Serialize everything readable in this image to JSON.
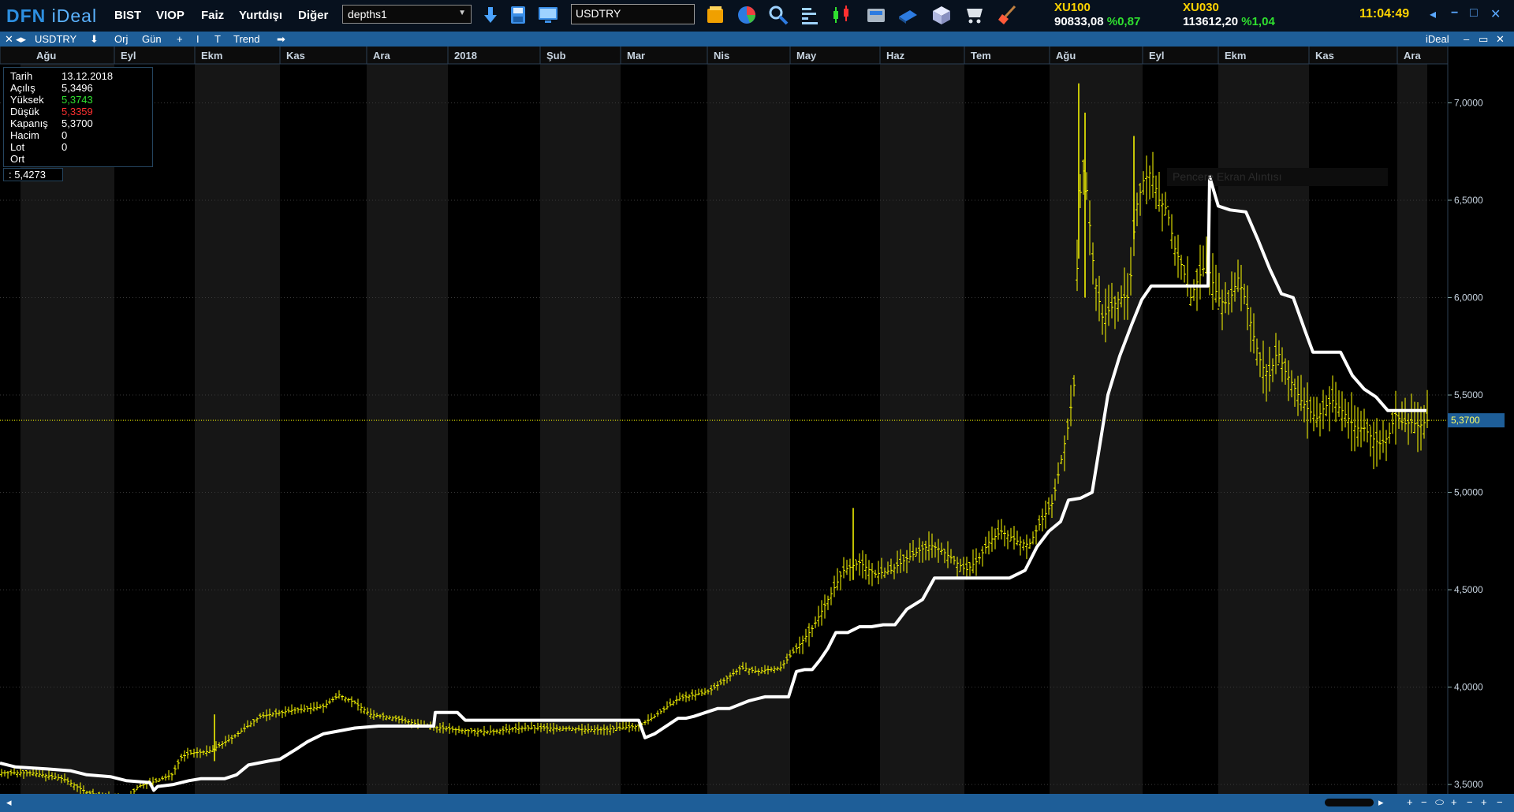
{
  "app": {
    "logo_main": "DFN",
    "logo_sub": "iDeal"
  },
  "menu": [
    {
      "label": "BIST"
    },
    {
      "label": "VIOP"
    },
    {
      "label": "Faiz"
    },
    {
      "label": "Yurtdışı"
    },
    {
      "label": "Diğer"
    }
  ],
  "layout_combo": {
    "value": "depths1"
  },
  "symbol_input": {
    "value": "USDTRY"
  },
  "toolbar_icons": [
    "download-arrow-icon",
    "save-file-icon",
    "monitor-icon",
    "folder-icon",
    "pie-chart-icon",
    "magnifier-icon",
    "align-lines-icon",
    "candlestick-icon",
    "calculator-icon",
    "book-icon",
    "cube-icon",
    "cart-icon",
    "broom-icon"
  ],
  "indices": [
    {
      "name": "XU100",
      "value": "90833,08",
      "pct": "%0,87"
    },
    {
      "name": "XU030",
      "value": "113612,20",
      "pct": "%1,04"
    }
  ],
  "clock": "11:04:49",
  "chart_toolbar": {
    "symbol": "USDTRY",
    "orj": "Orj",
    "period": "Gün",
    "trend": "Trend",
    "brand": "iDeal"
  },
  "info": {
    "rows": [
      {
        "key": "Tarih",
        "value": "13.12.2018",
        "color": "#ffffff"
      },
      {
        "key": "Açılış",
        "value": "5,3496",
        "color": "#ffffff"
      },
      {
        "key": "Yüksek",
        "value": "5,3743",
        "color": "#2fe02f"
      },
      {
        "key": "Düşük",
        "value": "5,3359",
        "color": "#ff3030"
      },
      {
        "key": "Kapanış",
        "value": "5,3700",
        "color": "#ffffff"
      },
      {
        "key": "Hacim",
        "value": "0",
        "color": "#ffffff"
      },
      {
        "key": "Lot",
        "value": "0",
        "color": "#ffffff"
      },
      {
        "key": "Ort",
        "value": "",
        "color": "#ffffff"
      }
    ],
    "cursor_value": ": 5,4273"
  },
  "watermark": "Pencere Ekran Alıntısı",
  "chart_data": {
    "type": "line",
    "title": "",
    "months": [
      "Ağu",
      "Eyl",
      "Ekm",
      "Kas",
      "Ara",
      "2018",
      "Şub",
      "Mar",
      "Nis",
      "May",
      "Haz",
      "Tem",
      "Ağu",
      "Eyl",
      "Ekm",
      "Kas",
      "Ara"
    ],
    "y_ticks": [
      "7,0000",
      "6,5000",
      "6,0000",
      "5,5000",
      "5,0000",
      "4,5000",
      "4,0000",
      "3,5000"
    ],
    "ylim": [
      3.46,
      7.18
    ],
    "last_price_label": "5,3700",
    "last_price": 5.37,
    "price_color": "#ffff00",
    "stop_color": "#ffffff",
    "price_series": {
      "name": "USDTRY",
      "points": [
        [
          0,
          3.56
        ],
        [
          40,
          3.56
        ],
        [
          80,
          3.53
        ],
        [
          110,
          3.46
        ],
        [
          130,
          3.44
        ],
        [
          160,
          3.42
        ],
        [
          175,
          3.49
        ],
        [
          200,
          3.52
        ],
        [
          218,
          3.55
        ],
        [
          230,
          3.64
        ],
        [
          240,
          3.66
        ],
        [
          265,
          3.67
        ],
        [
          295,
          3.74
        ],
        [
          330,
          3.85
        ],
        [
          370,
          3.88
        ],
        [
          410,
          3.9
        ],
        [
          430,
          3.96
        ],
        [
          450,
          3.92
        ],
        [
          470,
          3.86
        ],
        [
          500,
          3.84
        ],
        [
          540,
          3.8
        ],
        [
          580,
          3.78
        ],
        [
          620,
          3.77
        ],
        [
          660,
          3.79
        ],
        [
          700,
          3.79
        ],
        [
          760,
          3.78
        ],
        [
          810,
          3.8
        ],
        [
          830,
          3.85
        ],
        [
          860,
          3.94
        ],
        [
          880,
          3.96
        ],
        [
          900,
          3.98
        ],
        [
          920,
          4.04
        ],
        [
          940,
          4.1
        ],
        [
          960,
          4.08
        ],
        [
          990,
          4.1
        ],
        [
          1010,
          4.2
        ],
        [
          1030,
          4.3
        ],
        [
          1050,
          4.45
        ],
        [
          1070,
          4.6
        ],
        [
          1080,
          4.62
        ],
        [
          1090,
          4.64
        ],
        [
          1110,
          4.58
        ],
        [
          1130,
          4.6
        ],
        [
          1150,
          4.66
        ],
        [
          1165,
          4.7
        ],
        [
          1180,
          4.73
        ],
        [
          1195,
          4.7
        ],
        [
          1210,
          4.65
        ],
        [
          1225,
          4.6
        ],
        [
          1240,
          4.65
        ],
        [
          1255,
          4.75
        ],
        [
          1270,
          4.8
        ],
        [
          1290,
          4.75
        ],
        [
          1305,
          4.73
        ],
        [
          1320,
          4.85
        ],
        [
          1335,
          4.95
        ],
        [
          1345,
          5.15
        ],
        [
          1355,
          5.35
        ],
        [
          1362,
          5.55
        ],
        [
          1367,
          6.3
        ],
        [
          1372,
          6.7
        ],
        [
          1378,
          6.55
        ],
        [
          1388,
          6.1
        ],
        [
          1398,
          5.9
        ],
        [
          1410,
          5.95
        ],
        [
          1420,
          6.0
        ],
        [
          1432,
          6.0
        ],
        [
          1440,
          6.45
        ],
        [
          1450,
          6.6
        ],
        [
          1460,
          6.65
        ],
        [
          1470,
          6.5
        ],
        [
          1480,
          6.45
        ],
        [
          1490,
          6.25
        ],
        [
          1500,
          6.15
        ],
        [
          1510,
          6.0
        ],
        [
          1520,
          6.1
        ],
        [
          1530,
          6.18
        ],
        [
          1540,
          6.05
        ],
        [
          1548,
          5.98
        ],
        [
          1558,
          5.97
        ],
        [
          1570,
          6.1
        ],
        [
          1580,
          5.98
        ],
        [
          1590,
          5.8
        ],
        [
          1600,
          5.65
        ],
        [
          1610,
          5.6
        ],
        [
          1620,
          5.73
        ],
        [
          1630,
          5.62
        ],
        [
          1640,
          5.55
        ],
        [
          1650,
          5.47
        ],
        [
          1660,
          5.42
        ],
        [
          1670,
          5.38
        ],
        [
          1680,
          5.44
        ],
        [
          1690,
          5.47
        ],
        [
          1700,
          5.43
        ],
        [
          1710,
          5.38
        ],
        [
          1720,
          5.33
        ],
        [
          1730,
          5.33
        ],
        [
          1740,
          5.28
        ],
        [
          1750,
          5.25
        ],
        [
          1760,
          5.28
        ],
        [
          1770,
          5.4
        ],
        [
          1780,
          5.35
        ],
        [
          1790,
          5.36
        ],
        [
          1800,
          5.34
        ],
        [
          1810,
          5.37
        ]
      ]
    },
    "stop_series": {
      "name": "Trend",
      "points": [
        [
          0,
          3.61
        ],
        [
          20,
          3.59
        ],
        [
          60,
          3.58
        ],
        [
          90,
          3.57
        ],
        [
          110,
          3.55
        ],
        [
          140,
          3.54
        ],
        [
          160,
          3.52
        ],
        [
          190,
          3.51
        ],
        [
          195,
          3.47
        ],
        [
          200,
          3.49
        ],
        [
          220,
          3.5
        ],
        [
          240,
          3.52
        ],
        [
          255,
          3.53
        ],
        [
          270,
          3.53
        ],
        [
          285,
          3.53
        ],
        [
          300,
          3.55
        ],
        [
          315,
          3.6
        ],
        [
          340,
          3.62
        ],
        [
          355,
          3.63
        ],
        [
          375,
          3.68
        ],
        [
          390,
          3.72
        ],
        [
          410,
          3.76
        ],
        [
          450,
          3.79
        ],
        [
          480,
          3.8
        ],
        [
          520,
          3.8
        ],
        [
          550,
          3.8
        ],
        [
          552,
          3.87
        ],
        [
          580,
          3.87
        ],
        [
          590,
          3.83
        ],
        [
          640,
          3.83
        ],
        [
          700,
          3.83
        ],
        [
          760,
          3.83
        ],
        [
          810,
          3.83
        ],
        [
          818,
          3.74
        ],
        [
          830,
          3.76
        ],
        [
          860,
          3.84
        ],
        [
          870,
          3.84
        ],
        [
          880,
          3.85
        ],
        [
          895,
          3.87
        ],
        [
          910,
          3.89
        ],
        [
          925,
          3.89
        ],
        [
          950,
          3.93
        ],
        [
          970,
          3.95
        ],
        [
          1000,
          3.95
        ],
        [
          1010,
          4.08
        ],
        [
          1020,
          4.09
        ],
        [
          1030,
          4.09
        ],
        [
          1040,
          4.14
        ],
        [
          1050,
          4.2
        ],
        [
          1060,
          4.28
        ],
        [
          1075,
          4.28
        ],
        [
          1090,
          4.31
        ],
        [
          1105,
          4.31
        ],
        [
          1120,
          4.32
        ],
        [
          1135,
          4.32
        ],
        [
          1150,
          4.4
        ],
        [
          1170,
          4.45
        ],
        [
          1185,
          4.56
        ],
        [
          1200,
          4.56
        ],
        [
          1240,
          4.56
        ],
        [
          1280,
          4.56
        ],
        [
          1300,
          4.6
        ],
        [
          1315,
          4.72
        ],
        [
          1330,
          4.8
        ],
        [
          1345,
          4.85
        ],
        [
          1355,
          4.96
        ],
        [
          1370,
          4.97
        ],
        [
          1385,
          5.0
        ],
        [
          1395,
          5.25
        ],
        [
          1405,
          5.5
        ],
        [
          1420,
          5.7
        ],
        [
          1435,
          5.86
        ],
        [
          1448,
          5.99
        ],
        [
          1460,
          6.06
        ],
        [
          1475,
          6.06
        ],
        [
          1500,
          6.06
        ],
        [
          1525,
          6.06
        ],
        [
          1532,
          6.06
        ],
        [
          1534,
          6.62
        ],
        [
          1545,
          6.47
        ],
        [
          1560,
          6.45
        ],
        [
          1580,
          6.44
        ],
        [
          1595,
          6.3
        ],
        [
          1610,
          6.15
        ],
        [
          1625,
          6.02
        ],
        [
          1640,
          6.0
        ],
        [
          1655,
          5.83
        ],
        [
          1665,
          5.72
        ],
        [
          1680,
          5.72
        ],
        [
          1700,
          5.72
        ],
        [
          1715,
          5.6
        ],
        [
          1730,
          5.53
        ],
        [
          1745,
          5.49
        ],
        [
          1760,
          5.42
        ],
        [
          1780,
          5.42
        ],
        [
          1809,
          5.42
        ]
      ]
    }
  }
}
